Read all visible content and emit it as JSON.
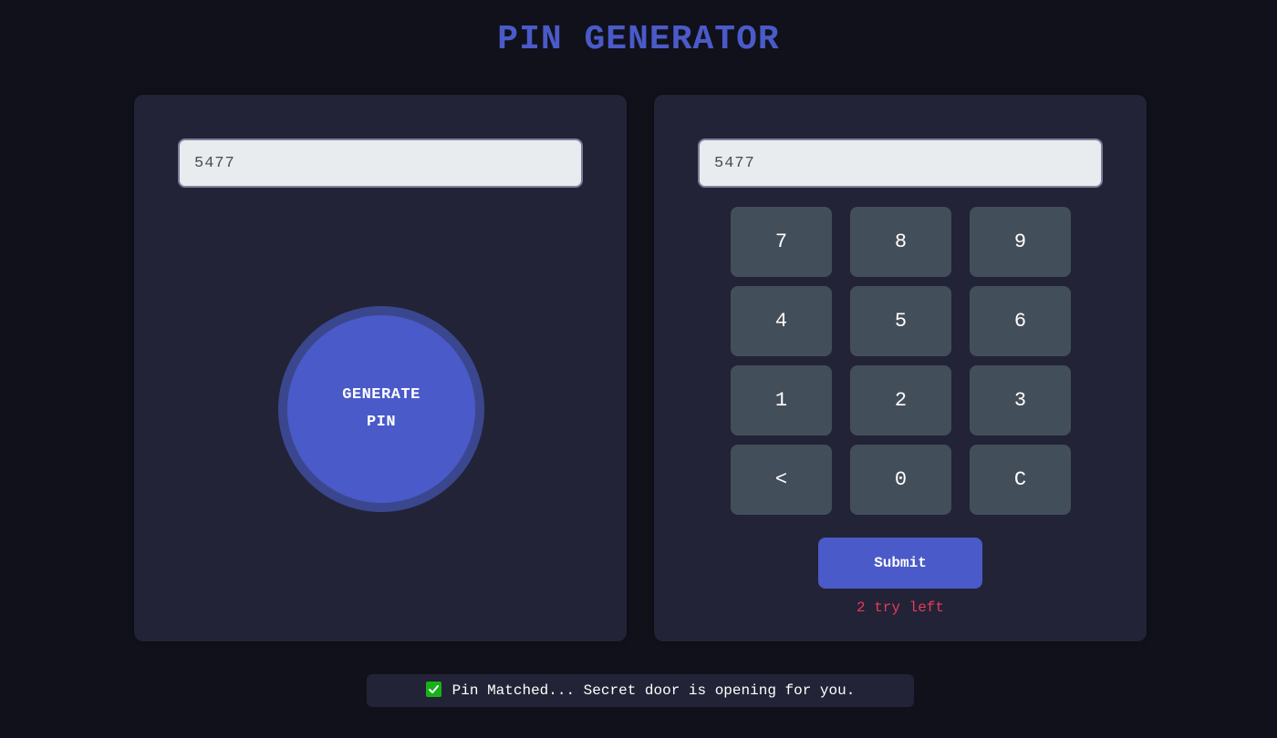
{
  "header": {
    "title": "PIN GENERATOR"
  },
  "generator": {
    "pin_value": "5477",
    "button_line1": "GENERATE",
    "button_line2": "PIN"
  },
  "verifier": {
    "typed_value": "5477",
    "keys": [
      "7",
      "8",
      "9",
      "4",
      "5",
      "6",
      "1",
      "2",
      "3",
      "<",
      "0",
      "C"
    ],
    "submit_label": "Submit",
    "tries_text": "2 try left"
  },
  "notification": {
    "icon": "check-mark-icon",
    "message": "Pin Matched... Secret door is opening for you."
  },
  "colors": {
    "background": "#10111a",
    "panel": "#222336",
    "accent": "#4a5ac8",
    "key": "#434e5b",
    "error": "#e83a5a",
    "success": "#17b21a"
  }
}
